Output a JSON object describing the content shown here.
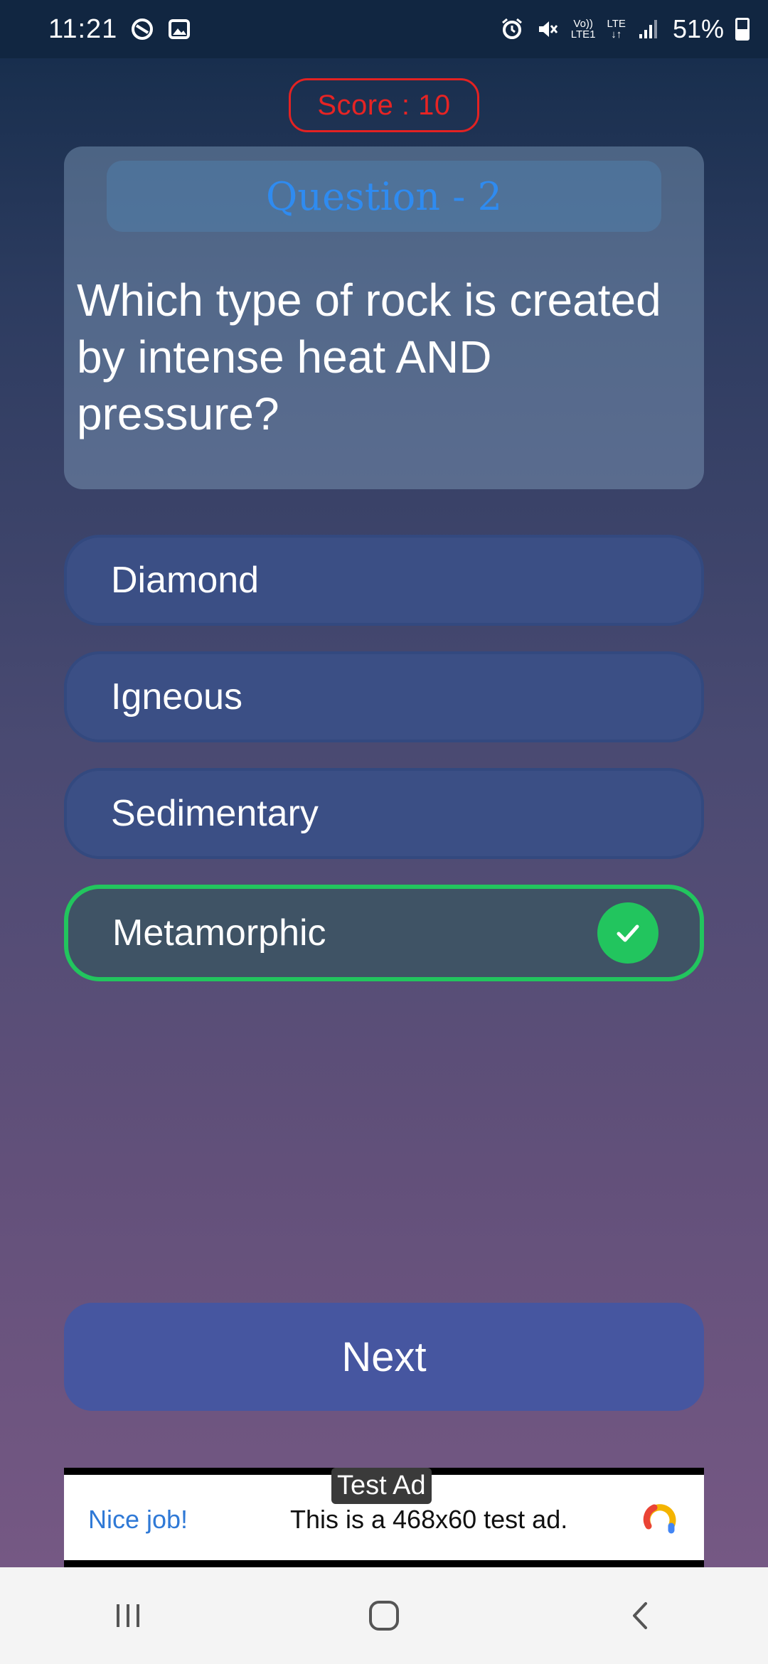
{
  "status_bar": {
    "time": "11:21",
    "lte1": "LTE1",
    "vol": "Vo))",
    "lte": "LTE",
    "battery": "51%"
  },
  "score": {
    "text": "Score : 10"
  },
  "question": {
    "header": "Question - 2",
    "text": "Which type of rock is created by intense heat AND pressure?"
  },
  "options": [
    {
      "label": "Diamond",
      "correct": false
    },
    {
      "label": "Igneous",
      "correct": false
    },
    {
      "label": "Sedimentary",
      "correct": false
    },
    {
      "label": "Metamorphic",
      "correct": true
    }
  ],
  "next_button": {
    "label": "Next"
  },
  "ad": {
    "label": "Test Ad",
    "nice": "Nice job!",
    "text": "This is a 468x60 test ad."
  },
  "colors": {
    "score_red": "#e32222",
    "question_header_blue": "#2f8bf0",
    "correct_green": "#22c55e",
    "next_button": "#4656a0"
  },
  "icons": {
    "status_left": [
      "do-not-disturb-icon",
      "gallery-icon"
    ],
    "status_right": [
      "alarm-icon",
      "mute-icon",
      "signal-icon",
      "battery-icon"
    ],
    "nav": [
      "recent-apps-icon",
      "home-icon",
      "back-icon"
    ]
  }
}
